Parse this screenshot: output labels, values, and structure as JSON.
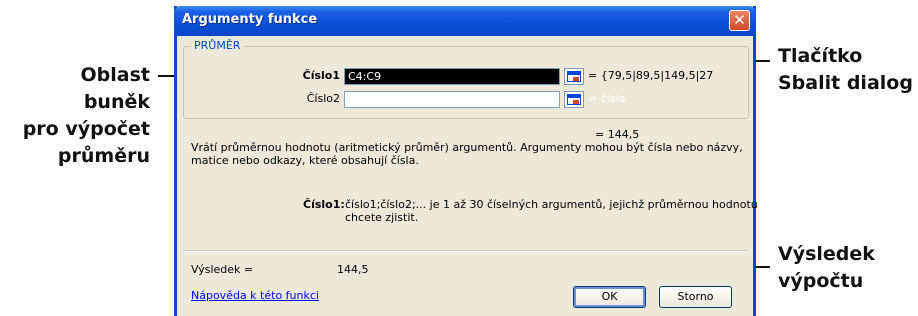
{
  "callouts": {
    "left": [
      "Oblast buněk",
      "pro výpočet",
      "průměru"
    ],
    "right_top": [
      "Tlačítko",
      "Sbalit dialog"
    ],
    "right_bottom": [
      "Výsledek",
      "výpočtu"
    ]
  },
  "dialog": {
    "title": "Argumenty funkce",
    "close_glyph": "✕",
    "function_name": "PRŮMĚR",
    "args": [
      {
        "label": "Číslo1",
        "value": "C4:C9",
        "result": "= {79,5|89,5|149,5|27"
      },
      {
        "label": "Číslo2",
        "value": "",
        "result": "= číslo"
      }
    ],
    "function_result": "= 144,5",
    "description": "Vrátí průměrnou hodnotu (aritmetický průměr) argumentů. Argumenty mohou být čísla nebo názvy, matice nebo odkazy, které obsahují čísla.",
    "arg_help_label": "Číslo1:",
    "arg_help_text": "číslo1;číslo2;... je 1 až 30 číselných argumentů, jejichž průměrnou hodnotu chcete zjistit.",
    "result_label": "Výsledek =",
    "result_value": "144,5",
    "help_link": "Nápověda k této funkci",
    "ok_label": "OK",
    "cancel_label": "Storno",
    "icons": {
      "collapse": "collapse-dialog-icon",
      "close": "close-icon"
    }
  }
}
